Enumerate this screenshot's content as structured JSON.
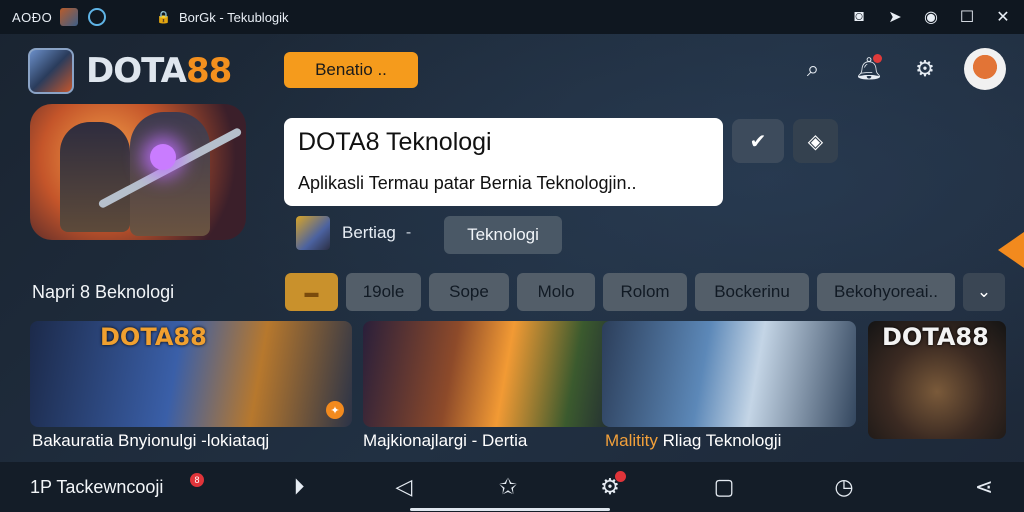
{
  "statusbar": {
    "time": "AOÐO",
    "url": "BorGk - Tekublogik",
    "icons": [
      "app-icon-a",
      "app-icon-b",
      "lock-icon",
      "screenshot-icon",
      "send-icon",
      "eye-icon",
      "maximize-icon",
      "close-icon"
    ]
  },
  "header": {
    "logo_part1": "DOTA",
    "logo_part2": "88",
    "cta_label": "Benatio ..",
    "icons": [
      "search-icon",
      "notification-bell-icon",
      "settings-icon",
      "avatar"
    ]
  },
  "hero": {
    "title": "DOTA8 Teknologi",
    "subtitle": "Aplikasli Termau patar Bernia Teknologjin..",
    "meta_label": "Bertiag",
    "meta_dash": "-",
    "meta_chip": "Teknologi"
  },
  "section": {
    "label": "Napri 8 Beknologi",
    "chips": [
      "",
      "19ole",
      "Sope",
      "Molo",
      "Rolom",
      "Bockerinu",
      "Bekohyoreai..",
      ""
    ]
  },
  "cards": [
    {
      "title": "Bakauratia Bnyionulgi -lokiataqj",
      "title_highlight": "",
      "badge": "DOTA88"
    },
    {
      "title": "Majkionajlargi - Dertia",
      "title_highlight": "",
      "badge": ""
    },
    {
      "title": " Rliag Teknologji",
      "title_highlight": "Malitity",
      "badge": ""
    },
    {
      "title": "",
      "title_highlight": "",
      "badge": "DOTA88"
    }
  ],
  "bottom_nav": {
    "label": "1P Tackewncooji",
    "badge": "8",
    "icons": [
      "play-icon",
      "tag-icon",
      "star-icon",
      "gear-icon",
      "square-icon",
      "clock-icon",
      "share-icon"
    ]
  },
  "colors": {
    "accent": "#f59b1c",
    "bg": "#1b2634",
    "chip": "#535e69"
  }
}
